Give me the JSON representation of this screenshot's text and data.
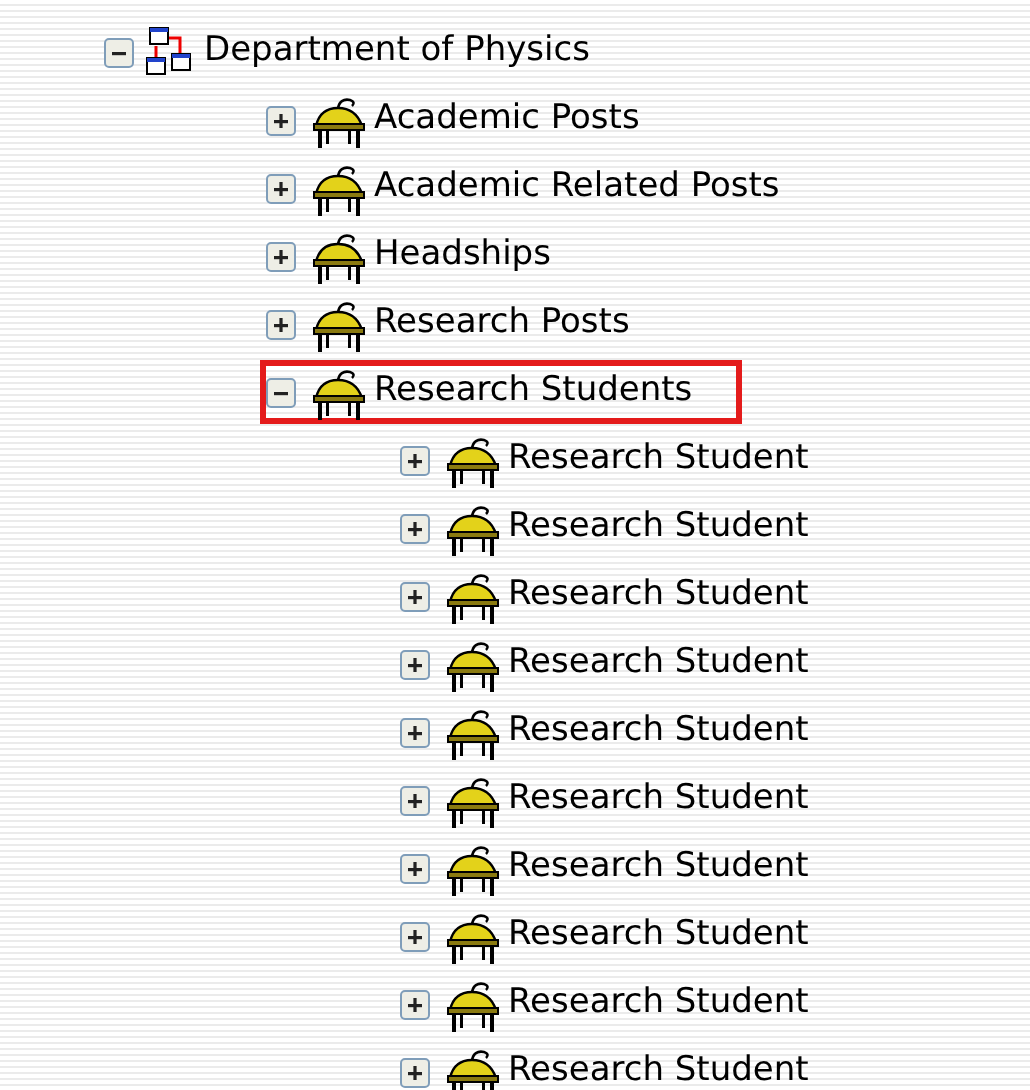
{
  "tree": [
    {
      "label": "Department of Physics",
      "kind": "department",
      "expanded": true,
      "outlined": false,
      "children": [
        {
          "label": "Academic Posts",
          "kind": "group",
          "expanded": false,
          "outlined": false
        },
        {
          "label": "Academic Related Posts",
          "kind": "group",
          "expanded": false,
          "outlined": false
        },
        {
          "label": "Headships",
          "kind": "group",
          "expanded": false,
          "outlined": false
        },
        {
          "label": "Research Posts",
          "kind": "group",
          "expanded": false,
          "outlined": false
        },
        {
          "label": "Research Students",
          "kind": "group",
          "expanded": true,
          "outlined": true,
          "children": [
            {
              "label": "Research Student",
              "kind": "group",
              "expanded": false,
              "outlined": false
            },
            {
              "label": "Research Student",
              "kind": "group",
              "expanded": false,
              "outlined": false
            },
            {
              "label": "Research Student",
              "kind": "group",
              "expanded": false,
              "outlined": false
            },
            {
              "label": "Research Student",
              "kind": "group",
              "expanded": false,
              "outlined": false
            },
            {
              "label": "Research Student",
              "kind": "group",
              "expanded": false,
              "outlined": false
            },
            {
              "label": "Research Student",
              "kind": "group",
              "expanded": false,
              "outlined": false
            },
            {
              "label": "Research Student",
              "kind": "group",
              "expanded": false,
              "outlined": false
            },
            {
              "label": "Research Student",
              "kind": "group",
              "expanded": false,
              "outlined": false
            },
            {
              "label": "Research Student",
              "kind": "group",
              "expanded": false,
              "outlined": false
            },
            {
              "label": "Research Student",
              "kind": "group",
              "expanded": false,
              "outlined": false
            }
          ]
        }
      ]
    }
  ]
}
